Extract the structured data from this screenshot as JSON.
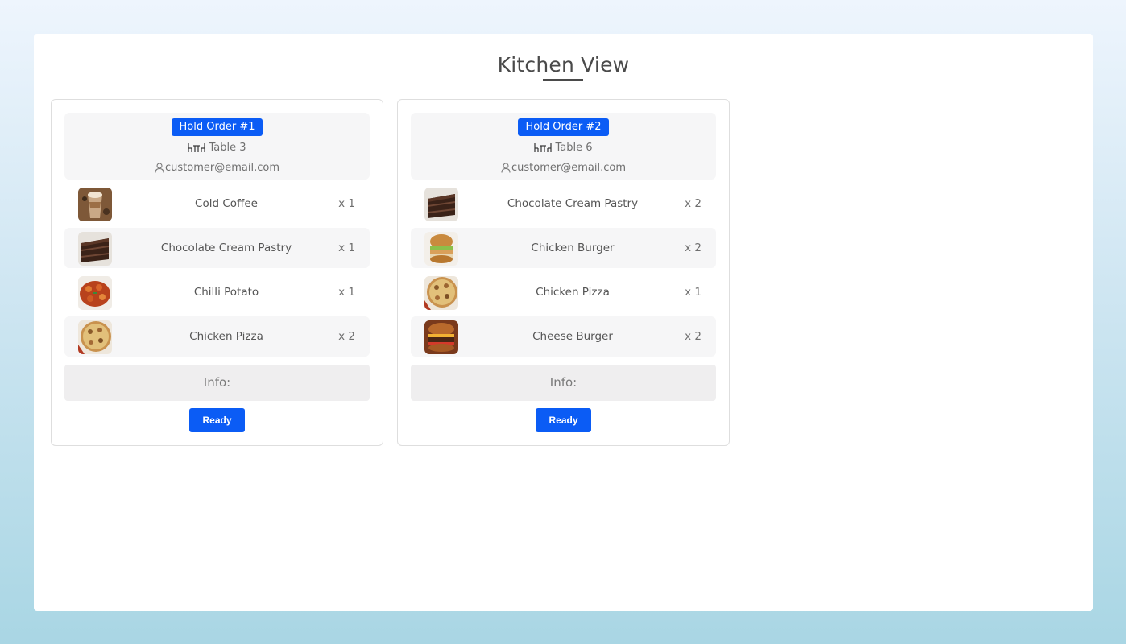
{
  "page": {
    "title": "Kitchen View"
  },
  "orders": [
    {
      "badge": "Hold Order #1",
      "table": "Table 3",
      "customer": "customer@email.com",
      "table_icon": "dining-table-icon",
      "customer_icon": "user-icon",
      "items": [
        {
          "name": "Cold Coffee",
          "qty": "x 1",
          "image": "cold-coffee"
        },
        {
          "name": "Chocolate Cream Pastry",
          "qty": "x 1",
          "image": "chocolate-cream-pastry"
        },
        {
          "name": "Chilli Potato",
          "qty": "x 1",
          "image": "chilli-potato"
        },
        {
          "name": "Chicken Pizza",
          "qty": "x 2",
          "image": "chicken-pizza"
        }
      ],
      "info_label": "Info:",
      "ready_label": "Ready"
    },
    {
      "badge": "Hold Order #2",
      "table": "Table 6",
      "customer": "customer@email.com",
      "table_icon": "dining-table-icon",
      "customer_icon": "user-icon",
      "items": [
        {
          "name": "Chocolate Cream Pastry",
          "qty": "x 2",
          "image": "chocolate-cream-pastry"
        },
        {
          "name": "Chicken Burger",
          "qty": "x 2",
          "image": "chicken-burger"
        },
        {
          "name": "Chicken Pizza",
          "qty": "x 1",
          "image": "chicken-pizza"
        },
        {
          "name": "Cheese Burger",
          "qty": "x 2",
          "image": "cheese-burger"
        }
      ],
      "info_label": "Info:",
      "ready_label": "Ready"
    }
  ],
  "colors": {
    "accent": "#0b5cf5",
    "title_text": "#4a4a4a",
    "header_bg": "#f6f6f7",
    "info_bg": "#efeeef"
  }
}
